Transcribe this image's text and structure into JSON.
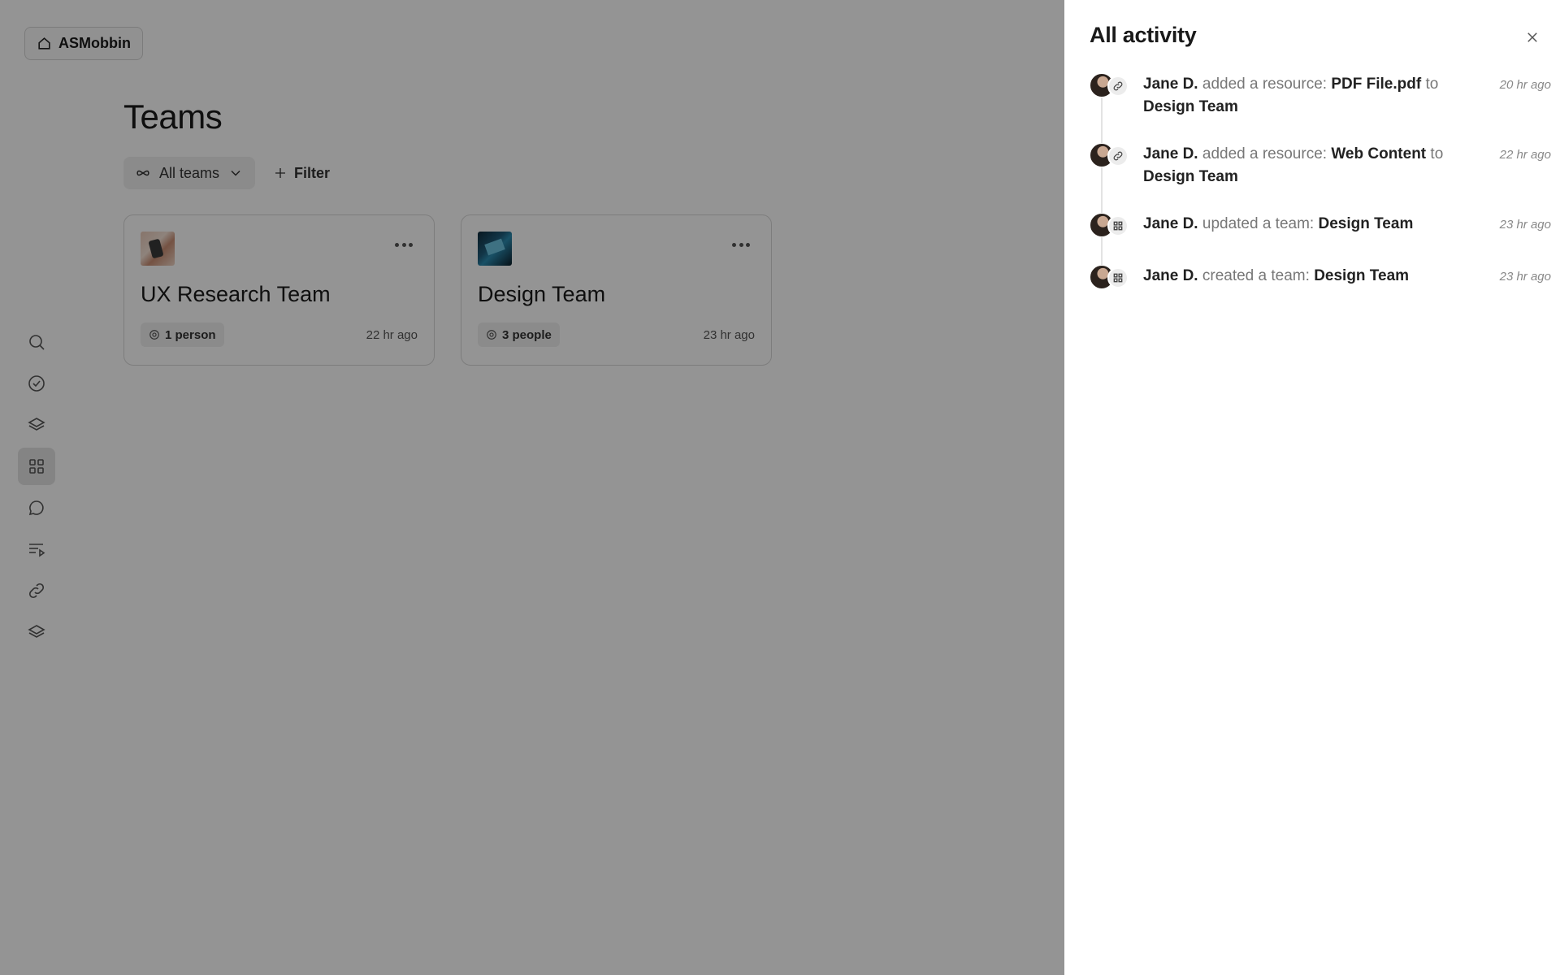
{
  "workspace": {
    "name": "ASMobbin",
    "icon": "home-icon"
  },
  "rail": [
    {
      "icon": "search-icon",
      "active": false
    },
    {
      "icon": "check-circle-icon",
      "active": false
    },
    {
      "icon": "layers-icon",
      "active": false
    },
    {
      "icon": "grid-icon",
      "active": true
    },
    {
      "icon": "chat-icon",
      "active": false
    },
    {
      "icon": "playlist-icon",
      "active": false
    },
    {
      "icon": "link-icon",
      "active": false
    },
    {
      "icon": "layers-icon",
      "active": false
    }
  ],
  "page": {
    "title": "Teams"
  },
  "toolbar": {
    "teams_label": "All teams",
    "filter_label": "Filter"
  },
  "cards": [
    {
      "title": "UX Research Team",
      "members": "1 person",
      "time": "22 hr ago"
    },
    {
      "title": "Design Team",
      "members": "3 people",
      "time": "23 hr ago"
    }
  ],
  "activity": {
    "title": "All activity",
    "items": [
      {
        "icon": "link-icon",
        "user": "Jane D.",
        "action": "added a resource:",
        "target": "PDF File.pdf",
        "connector": "to",
        "team": "Design Team",
        "time": "20 hr ago"
      },
      {
        "icon": "link-icon",
        "user": "Jane D.",
        "action": "added a resource:",
        "target": "Web Content",
        "connector": "to",
        "team": "Design Team",
        "time": "22 hr ago"
      },
      {
        "icon": "grid-icon",
        "user": "Jane D.",
        "action": "updated a team:",
        "target": "Design Team",
        "connector": "",
        "team": "",
        "time": "23 hr ago"
      },
      {
        "icon": "grid-icon",
        "user": "Jane D.",
        "action": "created a team:",
        "target": "Design Team",
        "connector": "",
        "team": "",
        "time": "23 hr ago"
      }
    ]
  }
}
